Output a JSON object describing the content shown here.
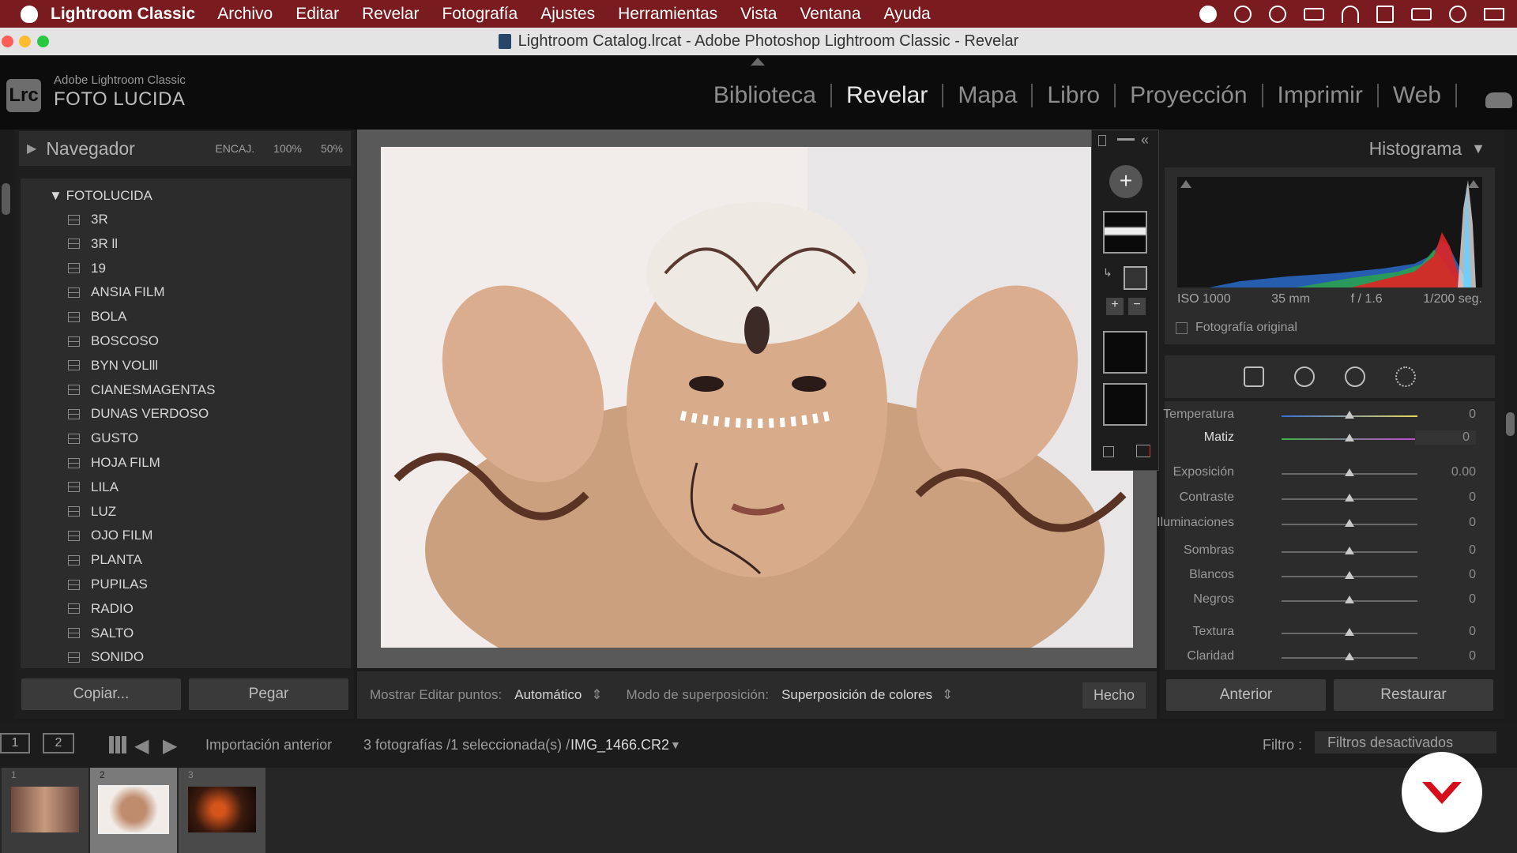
{
  "menubar": {
    "app": "Lightroom Classic",
    "items": [
      "Archivo",
      "Editar",
      "Revelar",
      "Fotografía",
      "Ajustes",
      "Herramientas",
      "Vista",
      "Ventana",
      "Ayuda"
    ]
  },
  "window": {
    "title": "Lightroom Catalog.lrcat - Adobe Photoshop Lightroom Classic - Revelar"
  },
  "identity": {
    "logo": "Lrc",
    "product": "Adobe Lightroom Classic",
    "name": "FOTO LUCIDA"
  },
  "modules": [
    "Biblioteca",
    "Revelar",
    "Mapa",
    "Libro",
    "Proyección",
    "Imprimir",
    "Web"
  ],
  "active_module": "Revelar",
  "navigator": {
    "title": "Navegador",
    "zoom": [
      "ENCAJ.",
      "100%",
      "50%"
    ]
  },
  "presets": {
    "folder": "FOTOLUCIDA",
    "items": [
      "3R",
      "3R ll",
      "19",
      "ANSIA FILM",
      "BOLA",
      "BOSCOSO",
      "BYN VOLlll",
      "CIANESMAGENTAS",
      "DUNAS VERDOSO",
      "GUSTO",
      "HOJA FILM",
      "LILA",
      "LUZ",
      "OJO FILM",
      "PLANTA",
      "PUPILAS",
      "RADIO",
      "SALTO",
      "SONIDO"
    ]
  },
  "left_buttons": {
    "copy": "Copiar...",
    "paste": "Pegar"
  },
  "toolbar": {
    "show_label": "Mostrar Editar puntos:",
    "show_value": "Automático",
    "overlay_label": "Modo de superposición:",
    "overlay_value": "Superposición de colores",
    "done": "Hecho"
  },
  "histogram": {
    "title": "Histograma",
    "iso": "ISO 1000",
    "focal": "35 mm",
    "aperture": "f / 1.6",
    "shutter": "1/200 seg.",
    "original": "Fotografía original"
  },
  "sliders": [
    {
      "label": "Temperatura",
      "value": "0",
      "fraction": 0.5
    },
    {
      "label": "Matiz",
      "value": "0",
      "fraction": 0.5
    },
    {
      "label": "Exposición",
      "value": "0.00",
      "fraction": 0.5
    },
    {
      "label": "Contraste",
      "value": "0",
      "fraction": 0.5
    },
    {
      "label": "Iluminaciones",
      "value": "0",
      "fraction": 0.5
    },
    {
      "label": "Sombras",
      "value": "0",
      "fraction": 0.5
    },
    {
      "label": "Blancos",
      "value": "0",
      "fraction": 0.5
    },
    {
      "label": "Negros",
      "value": "0",
      "fraction": 0.5
    },
    {
      "label": "Textura",
      "value": "0",
      "fraction": 0.5
    },
    {
      "label": "Claridad",
      "value": "0",
      "fraction": 0.5
    }
  ],
  "right_buttons": {
    "previous": "Anterior",
    "reset": "Restaurar"
  },
  "filmbar": {
    "monitor1": "1",
    "monitor2": "2",
    "source": "Importación anterior",
    "count": "3 fotografías /1 seleccionada(s) /",
    "file": "IMG_1466.CR2",
    "filter_label": "Filtro :",
    "filter_value": "Filtros desactivados"
  },
  "filmstrip": {
    "numbers": [
      "1",
      "2",
      "3"
    ]
  },
  "colors": {
    "menubar": "#7a1b20",
    "accent": "#e6e6e6",
    "badge": "#d40f1b"
  }
}
